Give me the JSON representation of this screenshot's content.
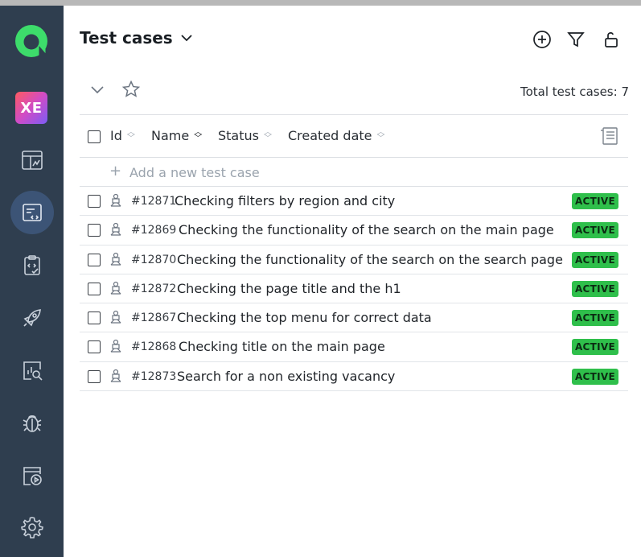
{
  "header": {
    "title": "Test cases"
  },
  "sidebar": {
    "avatar_initials": "XE",
    "items": [
      {
        "icon": "dashboard-icon"
      },
      {
        "icon": "test-cases-icon"
      },
      {
        "icon": "test-plans-icon"
      },
      {
        "icon": "launches-icon"
      },
      {
        "icon": "analytics-icon"
      },
      {
        "icon": "defects-icon"
      },
      {
        "icon": "runs-icon"
      },
      {
        "icon": "settings-icon"
      }
    ]
  },
  "toolbar": {
    "total_label": "Total test cases: 7"
  },
  "table": {
    "columns": {
      "id": "Id",
      "name": "Name",
      "status": "Status",
      "created": "Created date"
    },
    "add_label": "Add a new test case",
    "rows": [
      {
        "id": "#12871",
        "name": "Checking filters by region and city",
        "status": "ACTIVE"
      },
      {
        "id": "#12869",
        "name": "Checking the functionality of the search on the main page",
        "status": "ACTIVE"
      },
      {
        "id": "#12870",
        "name": "Checking the functionality of the search on the search page",
        "status": "ACTIVE"
      },
      {
        "id": "#12872",
        "name": "Checking the page title and the h1",
        "status": "ACTIVE"
      },
      {
        "id": "#12867",
        "name": "Checking the top menu for correct data",
        "status": "ACTIVE"
      },
      {
        "id": "#12868",
        "name": "Checking title on the main page",
        "status": "ACTIVE"
      },
      {
        "id": "#12873",
        "name": "Search for a non existing vacancy",
        "status": "ACTIVE"
      }
    ]
  },
  "colors": {
    "sidebar_bg": "#2f3e4f",
    "accent_green": "#2fbf4b",
    "logo_green": "#3ddc6b"
  }
}
